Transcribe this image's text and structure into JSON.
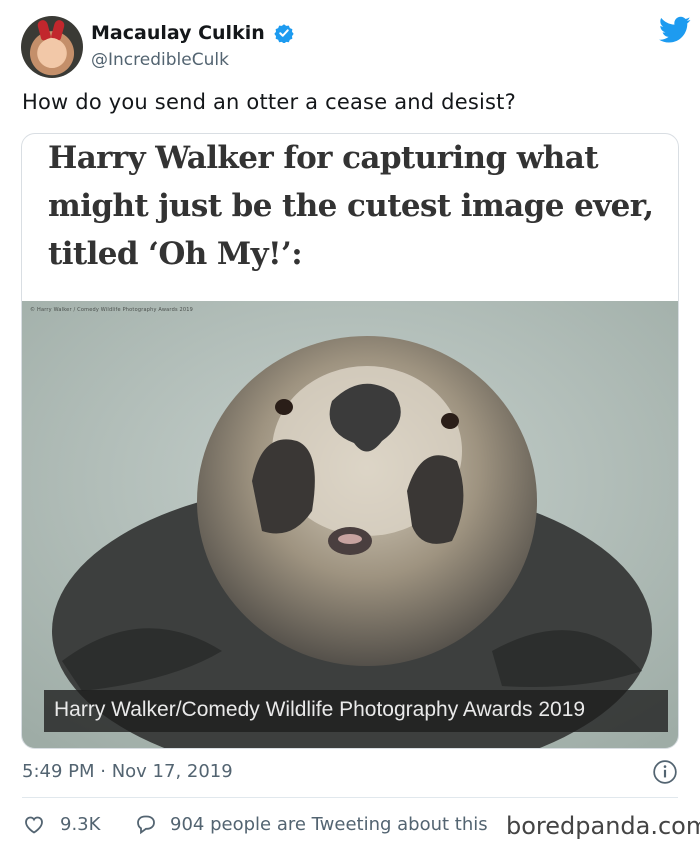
{
  "user": {
    "display_name": "Macaulay Culkin",
    "handle": "@IncredibleCulk",
    "verified": true,
    "avatar_icon": "avatar-photo"
  },
  "tweet": {
    "text": "How do you send an otter a cease and desist?",
    "timestamp": "5:49 PM · Nov 17, 2019",
    "likes": "9.3K",
    "tweeting_about": "904 people are Tweeting about this"
  },
  "embedded_card": {
    "title": "Harry Walker for capturing what might just be the cutest image ever, titled ‘Oh My!’:",
    "caption": "Harry Walker/Comedy Wildlife Photography Awards 2019",
    "small_credit": "© Harry Walker / Comedy Wildlife Photography Awards 2019"
  },
  "watermark": "boredpanda.com",
  "colors": {
    "twitter_blue": "#1d9bf0",
    "secondary_text": "#536471",
    "divider": "#e1e8ed"
  },
  "icons": [
    "verified-badge-icon",
    "twitter-bird-icon",
    "info-icon",
    "heart-icon",
    "reply-bubble-icon"
  ]
}
